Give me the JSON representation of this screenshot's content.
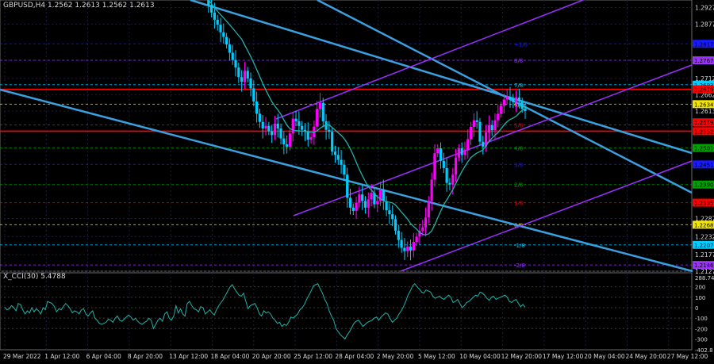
{
  "window": {
    "symbol": "GBPUSD,H4",
    "ohlc": "1.2562 1.2613 1.2562 1.2613",
    "indicator": "X_CCI(30) 5.4788"
  },
  "colors": {
    "background": "#000000",
    "bull": "#ff00ff",
    "bear": "#00ccff",
    "ma": "#20b2aa",
    "cci": "#20b2aa",
    "channel": "#3aa0e0",
    "pitchfork": "#9b30ff",
    "grid": "#1c1c3a",
    "resistance": "#ff0000"
  },
  "chart_data": [
    {
      "type": "candlestick",
      "title": "GBPUSD,H4",
      "ylim": [
        1.2127,
        1.295
      ],
      "y_ticks": [
        "1.2927",
        "1.2877",
        "1.2767",
        "1.2712",
        "1.2662",
        "1.2613",
        "1.2552",
        "1.2287",
        "1.2232",
        "1.2177",
        "1.2127"
      ],
      "x_ticks": [
        "29 Mar 2022",
        "1 Apr 12:00",
        "6 Apr 04:00",
        "8 Apr 20:00",
        "13 Apr 12:00",
        "18 Apr 04:00",
        "20 Apr 20:00",
        "25 Apr 12:00",
        "28 Apr 04:00",
        "2 May 20:00",
        "5 May 12:00",
        "10 May 04:00",
        "12 May 20:00",
        "17 May 12:00",
        "20 May 04:00",
        "24 May 20:00",
        "27 May 12:00"
      ],
      "series_close": [
        1.2968,
        1.2935,
        1.2912,
        1.289,
        1.2875,
        1.2852,
        1.2838,
        1.2815,
        1.279,
        1.2768,
        1.2745,
        1.2716,
        1.2702,
        1.2735,
        1.2712,
        1.2682,
        1.2642,
        1.2605,
        1.258,
        1.256,
        1.2568,
        1.2552,
        1.254,
        1.2575,
        1.256,
        1.253,
        1.2512,
        1.2505,
        1.2545,
        1.259,
        1.2582,
        1.2568,
        1.2556,
        1.2552,
        1.2526,
        1.2534,
        1.2566,
        1.262,
        1.2638,
        1.2582,
        1.2556,
        1.255,
        1.249,
        1.248,
        1.2465,
        1.245,
        1.242,
        1.235,
        1.232,
        1.231,
        1.2335,
        1.236,
        1.234,
        1.232,
        1.2345,
        1.2365,
        1.233,
        1.234,
        1.2375,
        1.234,
        1.2312,
        1.23,
        1.2285,
        1.225,
        1.2222,
        1.2198,
        1.2188,
        1.2202,
        1.219,
        1.2216,
        1.2232,
        1.225,
        1.226,
        1.229,
        1.234,
        1.2405,
        1.2485,
        1.25,
        1.2462,
        1.244,
        1.2395,
        1.239,
        1.242,
        1.2472,
        1.25,
        1.248,
        1.2496,
        1.2528,
        1.2565,
        1.2585,
        1.258,
        1.252,
        1.2505,
        1.2548,
        1.257,
        1.2555,
        1.2585,
        1.2605,
        1.263,
        1.2648,
        1.2656,
        1.265,
        1.264,
        1.2654,
        1.2642,
        1.262,
        1.2613
      ],
      "price_labels": [
        {
          "text": "1.2817",
          "color": "#1a1aff"
        },
        {
          "text": "1.2767",
          "color": "#9b30ff"
        },
        {
          "text": "1.2693",
          "color": "#00ccff"
        },
        {
          "text": "1.2679",
          "color": "#ff0000"
        },
        {
          "text": "1.2634",
          "color": "#f2e600"
        },
        {
          "text": "1.2579",
          "color": "#ff0000"
        },
        {
          "text": "1.2552",
          "color": "#ff0000"
        },
        {
          "text": "1.2501",
          "color": "#00a000"
        },
        {
          "text": "1.2451",
          "color": "#1a1aff"
        },
        {
          "text": "1.2390",
          "color": "#00a000"
        },
        {
          "text": "1.2335",
          "color": "#ff0000"
        },
        {
          "text": "1.2268",
          "color": "#f2e600"
        },
        {
          "text": "1.2207",
          "color": "#00ccff"
        },
        {
          "text": "1.2146",
          "color": "#9b30ff"
        }
      ],
      "levels": [
        {
          "label": "+1/8",
          "price": 1.2817,
          "color": "#1a1aff"
        },
        {
          "label": "8/8",
          "price": 1.2767,
          "color": "#9b30ff"
        },
        {
          "label": "7/8",
          "price": 1.2693,
          "color": "#00ccff"
        },
        {
          "label": "6/8",
          "price": 1.2634,
          "color": "#f2e600"
        },
        {
          "label": "5/8",
          "price": 1.2571,
          "color": "#ff0000"
        },
        {
          "label": "4/8",
          "price": 1.2501,
          "color": "#00a000"
        },
        {
          "label": "3/8",
          "price": 1.2451,
          "color": "#1a1aff"
        },
        {
          "label": "2/8",
          "price": 1.239,
          "color": "#00a000"
        },
        {
          "label": "1/8",
          "price": 1.2335,
          "color": "#ff0000"
        },
        {
          "label": "0/8",
          "price": 1.2268,
          "color": "#f2e600"
        },
        {
          "label": "-1/8",
          "price": 1.2207,
          "color": "#00ccff"
        },
        {
          "label": "-2/8",
          "price": 1.2146,
          "color": "#9b30ff"
        }
      ],
      "murray_marks": [
        "+1/8",
        "8/8",
        "7/8",
        "6/8",
        "5/8",
        "4/8",
        "3/8",
        "2/8",
        "1/8",
        "0/8",
        "-1/8",
        "-2/8"
      ],
      "resistance_prices": [
        1.2679,
        1.2552
      ]
    },
    {
      "type": "line",
      "title": "X_CCI(30) 5.4788",
      "ylim": [
        -402.8,
        288.7
      ],
      "y_ticks": [
        "288.7463",
        "200",
        "100",
        "0",
        "-100",
        "-200",
        "-402.8",
        "-300"
      ],
      "values": [
        5,
        -20,
        -10,
        20,
        0,
        -30,
        40,
        30,
        -20,
        -60,
        -30,
        -50,
        0,
        -40,
        -10,
        -30,
        -60,
        0,
        -20,
        60,
        50,
        40,
        10,
        -40,
        -10,
        -20,
        10,
        40,
        20,
        -10,
        -50,
        -30,
        -40,
        -60,
        -20,
        -10,
        -60,
        -80,
        -50,
        -30,
        -100,
        -120,
        -150,
        -160,
        -150,
        -140,
        -110,
        -120,
        -140,
        -100,
        -80,
        -120,
        -130,
        -110,
        -90,
        -70,
        -90,
        -120,
        -100,
        -130,
        -150,
        -160,
        -140,
        -130,
        -100,
        -120,
        -200,
        -160,
        -120,
        -100,
        -130,
        -60,
        -40,
        -100,
        -120,
        -80,
        20,
        -50,
        -10,
        -60,
        -80,
        40,
        60,
        20,
        -10,
        -20,
        -40,
        10,
        0,
        -60,
        -40,
        -20,
        -50,
        -70,
        -20,
        20,
        50,
        80,
        120,
        160,
        200,
        220,
        180,
        150,
        120,
        110,
        140,
        60,
        -10,
        20,
        30,
        40,
        0,
        -60,
        -80,
        -30,
        -50,
        -40,
        -60,
        -100,
        -120,
        -150,
        -140,
        -180,
        -160,
        -170,
        -140,
        -90,
        -100,
        -80,
        -60,
        -20,
        0,
        30,
        80,
        120,
        160,
        210,
        220,
        230,
        180,
        140,
        80,
        40,
        -30,
        -80,
        -120,
        -200,
        -230,
        -260,
        -280,
        -300,
        -260,
        -230,
        -190,
        -150,
        -130,
        -120,
        -150,
        -180,
        -160,
        -140,
        -130,
        -120,
        -100,
        -90,
        -120,
        -90,
        -70,
        -50,
        -60,
        -100,
        -140,
        -120,
        -100,
        -60,
        -30,
        10,
        60,
        120,
        160,
        210,
        230,
        200,
        180,
        150,
        140,
        170,
        160,
        150,
        110,
        90,
        100,
        110,
        90,
        80,
        100,
        120,
        100,
        50,
        60,
        80,
        40,
        0,
        20,
        50,
        60,
        80,
        100,
        120,
        110,
        150,
        140,
        120,
        90,
        70,
        100,
        110,
        80,
        90,
        100,
        110,
        120,
        100,
        60,
        50,
        70,
        80,
        40,
        10,
        30,
        5
      ]
    }
  ]
}
